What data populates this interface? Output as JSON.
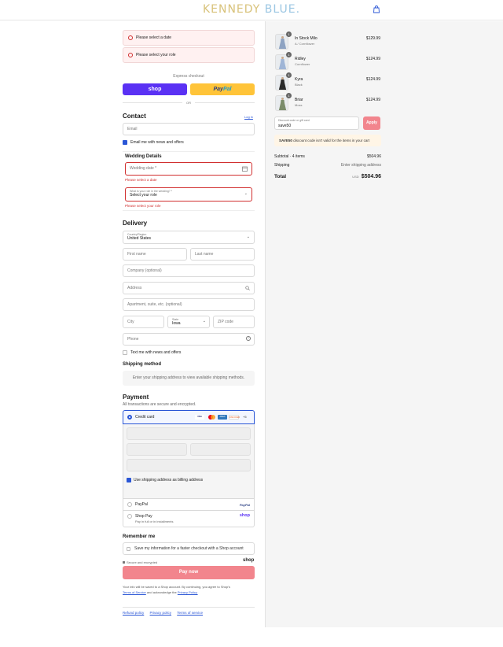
{
  "brand": {
    "part1": "KENNEDY",
    "part2": "BLUE.",
    "color1": "#d8c27a",
    "color2": "#9cc7e3"
  },
  "errors": {
    "date_banner": "Please select a date",
    "role_banner": "Please select your role"
  },
  "express": {
    "label": "Express checkout",
    "shop_label": "shop",
    "paypal_1": "Pay",
    "paypal_2": "Pal",
    "or": "OR"
  },
  "contact": {
    "title": "Contact",
    "login": "Log in",
    "email_placeholder": "Email",
    "newsletter": "Email me with news and offers"
  },
  "wedding": {
    "title": "Wedding Details",
    "date_placeholder": "Wedding date *",
    "date_error": "Please select a date",
    "role_label": "What is your role in the wedding? *",
    "role_value": "Select your role",
    "role_error": "Please select your role"
  },
  "delivery": {
    "title": "Delivery",
    "country_label": "Country/Region",
    "country_value": "United States",
    "first_name": "First name",
    "last_name": "Last name",
    "company": "Company (optional)",
    "address": "Address",
    "apartment": "Apartment, suite, etc. (optional)",
    "city": "City",
    "state_label": "State",
    "state_value": "Iowa",
    "zip": "ZIP code",
    "phone": "Phone",
    "text_me": "Text me with news and offers"
  },
  "shipping": {
    "title": "Shipping method",
    "message": "Enter your shipping address to view available shipping methods."
  },
  "payment": {
    "title": "Payment",
    "subtitle": "All transactions are secure and encrypted.",
    "credit_card": "Credit card",
    "cards": [
      "VISA",
      "MC",
      "AMEX",
      "DISCOVER"
    ],
    "more_cards": "+5",
    "billing_same": "Use shipping address as billing address",
    "paypal_label": "PayPal",
    "paypal_logo": "PayPal",
    "shoppay_label": "Shop Pay",
    "shoppay_sub": "Pay in full or in installments",
    "shoppay_logo": "shop"
  },
  "remember": {
    "title": "Remember me",
    "save_info": "Save my information for a faster checkout with a Shop account",
    "secure": "Secure and encrypted",
    "shop_logo": "shop"
  },
  "pay_now": "Pay now",
  "legal": {
    "line1": "Your info will be saved to a Shop account. By continuing, you agree to Shop's",
    "terms": "Terms of Service",
    "and": "and acknowledge the",
    "privacy": "Privacy Policy."
  },
  "footer": {
    "refund": "Refund policy",
    "privacy": "Privacy policy",
    "terms": "Terms of service"
  },
  "cart": {
    "items": [
      {
        "name": "In Stock Milo",
        "variant": "A / Cornflower",
        "price": "$129.99",
        "qty": "1",
        "dress_color": "#8ea3c2"
      },
      {
        "name": "Ridley",
        "variant": "Cornflower",
        "price": "$124.99",
        "qty": "1",
        "dress_color": "#9fb5d6"
      },
      {
        "name": "Kyra",
        "variant": "Black",
        "price": "$124.99",
        "qty": "1",
        "dress_color": "#2a2a2a"
      },
      {
        "name": "Briar",
        "variant": "Moss",
        "price": "$124.99",
        "qty": "1",
        "dress_color": "#7b8c6a"
      }
    ],
    "discount_label": "Discount code or gift card",
    "discount_value": "save50",
    "apply": "Apply",
    "discount_code": "SAVE50",
    "discount_msg": "discount code isn't valid for the items in your cart",
    "subtotal_label": "Subtotal · 4 items",
    "subtotal_value": "$504.96",
    "shipping_label": "Shipping",
    "shipping_value": "Enter shipping address",
    "total_label": "Total",
    "currency": "USD",
    "total_value": "$504.96"
  },
  "colors": {
    "accent": "#2a56d6",
    "error": "#d12f2f",
    "paynow": "#f2858d",
    "shop": "#5a31f4",
    "paypal": "#ffc439"
  }
}
